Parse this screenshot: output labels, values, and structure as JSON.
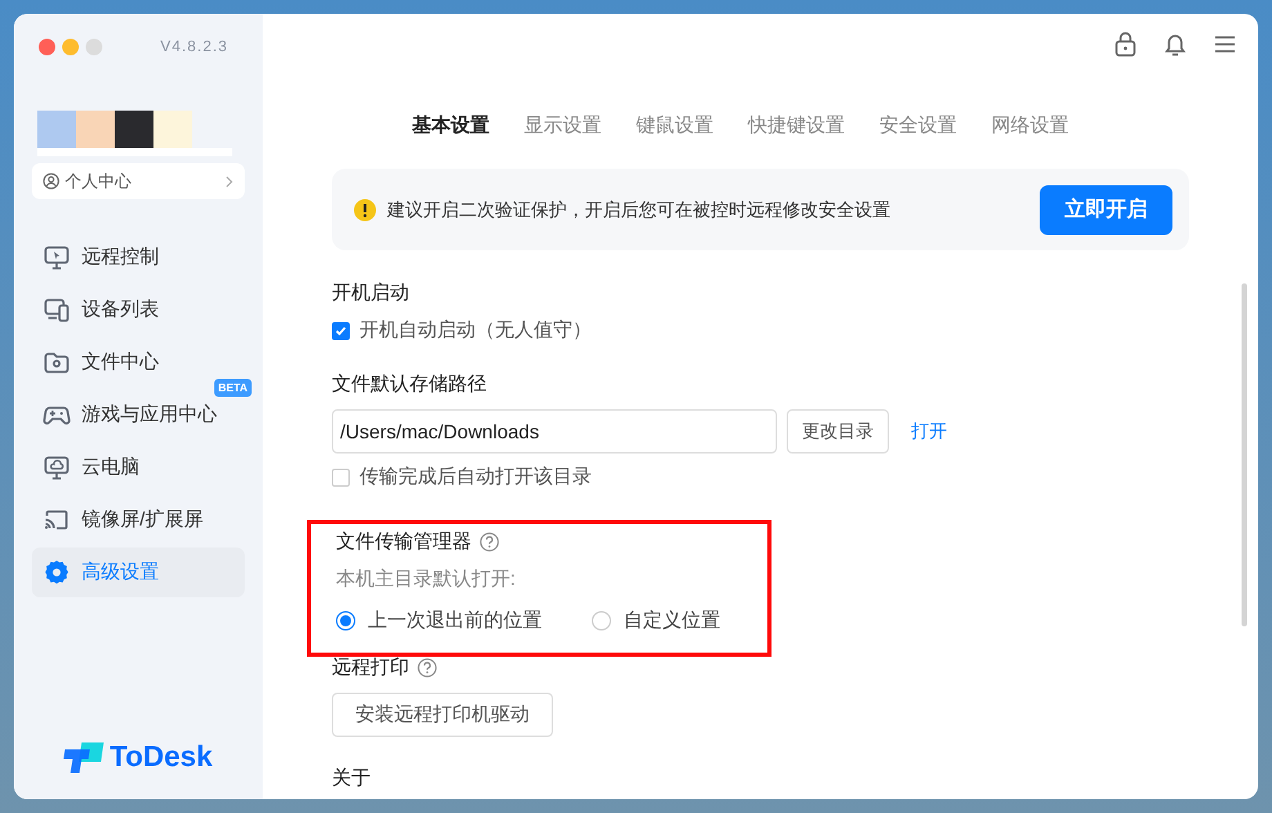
{
  "window": {
    "version": "V4.8.2.3"
  },
  "sidebar": {
    "profile_link": "个人中心",
    "items": [
      {
        "label": "远程控制",
        "selected": false
      },
      {
        "label": "设备列表",
        "selected": false
      },
      {
        "label": "文件中心",
        "selected": false
      },
      {
        "label": "游戏与应用中心",
        "selected": false,
        "badge": "BETA"
      },
      {
        "label": "云电脑",
        "selected": false
      },
      {
        "label": "镜像屏/扩展屏",
        "selected": false
      },
      {
        "label": "高级设置",
        "selected": true
      }
    ],
    "logo": "ToDesk"
  },
  "tabs": [
    {
      "label": "基本设置",
      "selected": true
    },
    {
      "label": "显示设置",
      "selected": false
    },
    {
      "label": "键鼠设置",
      "selected": false
    },
    {
      "label": "快捷键设置",
      "selected": false
    },
    {
      "label": "安全设置",
      "selected": false
    },
    {
      "label": "网络设置",
      "selected": false
    }
  ],
  "notice": {
    "text": "建议开启二次验证保护，开启后您可在被控时远程修改安全设置",
    "button": "立即开启"
  },
  "startup": {
    "title": "开机启动",
    "checkbox": {
      "label": "开机自动启动（无人值守）",
      "checked": true
    }
  },
  "storage": {
    "title": "文件默认存储路径",
    "path": "/Users/mac/Downloads",
    "change_button": "更改目录",
    "open_link": "打开",
    "checkbox": {
      "label": "传输完成后自动打开该目录",
      "checked": false
    }
  },
  "file_manager": {
    "title": "文件传输管理器",
    "highlighted": true,
    "subtitle": "本机主目录默认打开:",
    "options": [
      {
        "label": "上一次退出前的位置",
        "selected": true
      },
      {
        "label": "自定义位置",
        "selected": false
      }
    ]
  },
  "remote_print": {
    "title": "远程打印",
    "button": "安装远程打印机驱动"
  },
  "about": {
    "title": "关于"
  }
}
